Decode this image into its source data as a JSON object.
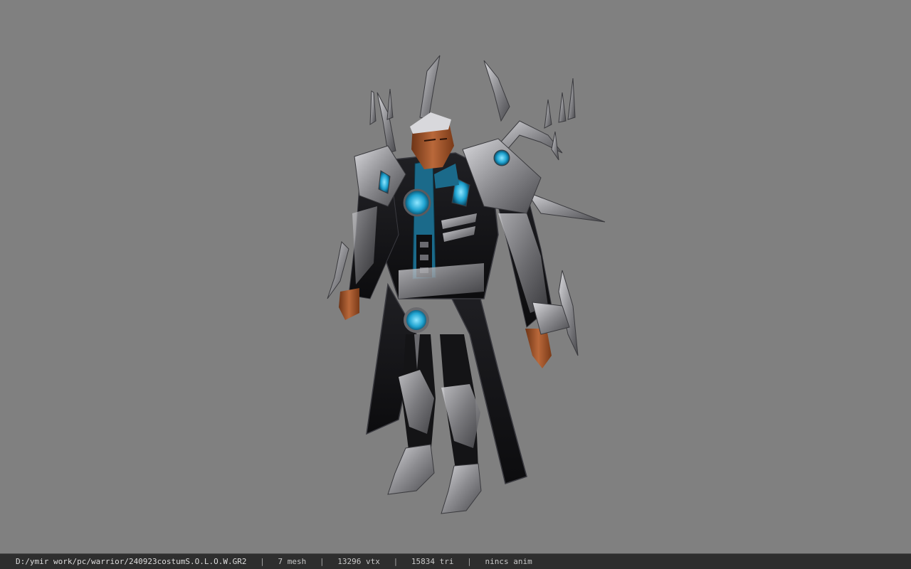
{
  "viewport": {
    "background_color": "#808080",
    "model_description_icon": "armored-warrior-model"
  },
  "status_bar": {
    "file_path": "D:/ymir work/pc/warrior/240923costumS.O.L.O.W.GR2",
    "separator": "|",
    "mesh_count": "7 mesh",
    "vertex_count": "13296 vtx",
    "triangle_count": "15834 tri",
    "animation": "nincs anim"
  },
  "colors": {
    "armor_black": "#141416",
    "armor_silver": "#9a9a9e",
    "gem_blue": "#1fa3d0",
    "skin": "#a0542a",
    "status_bg": "#2e2e2e"
  }
}
